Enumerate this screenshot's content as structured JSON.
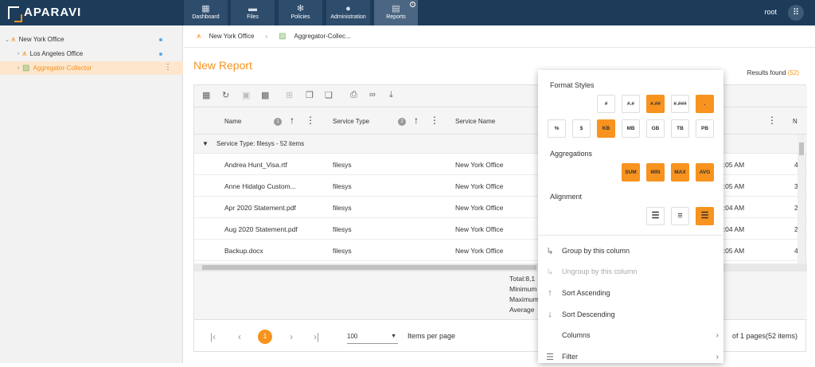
{
  "brand": {
    "name": "APARAVI"
  },
  "nav": {
    "tabs": [
      {
        "label": "Dashboard",
        "icon": "dashboard-icon"
      },
      {
        "label": "Files",
        "icon": "folder-icon"
      },
      {
        "label": "Policies",
        "icon": "gear-icon"
      },
      {
        "label": "Administration",
        "icon": "users-icon"
      },
      {
        "label": "Reports",
        "icon": "clipboard-icon"
      }
    ],
    "user": "root"
  },
  "tree": {
    "items": [
      {
        "label": "New York Office",
        "level": 0
      },
      {
        "label": "Los Angeles Office",
        "level": 1
      },
      {
        "label": "Aggregator-Collector",
        "level": 1,
        "selected": true
      }
    ]
  },
  "breadcrumb": {
    "items": [
      "New York Office",
      "Aggregator-Collec..."
    ]
  },
  "report": {
    "title": "New Report",
    "results_label": "Results found",
    "results_count": "(52)"
  },
  "grid": {
    "columns": [
      {
        "label": "Name",
        "sort_index": "1"
      },
      {
        "label": "Service Type",
        "sort_index": "2"
      },
      {
        "label": "Service Name"
      },
      {
        "label": "N"
      }
    ],
    "group_label": "Service Type: filesys - 52 items",
    "rows": [
      {
        "name": "Andrea Hunt_Visa.rtf",
        "type": "filesys",
        "service": "New York Office",
        "time": "3:05 AM",
        "extra": "4"
      },
      {
        "name": "Anne Hidalgo Custom...",
        "type": "filesys",
        "service": "New York Office",
        "time": "3:05 AM",
        "extra": "3"
      },
      {
        "name": "Apr 2020 Statement.pdf",
        "type": "filesys",
        "service": "New York Office",
        "time": "3:04 AM",
        "extra": "2"
      },
      {
        "name": "Aug 2020 Statement.pdf",
        "type": "filesys",
        "service": "New York Office",
        "time": "3:04 AM",
        "extra": "2"
      },
      {
        "name": "Backup.docx",
        "type": "filesys",
        "service": "New York Office",
        "time": "3:05 AM",
        "extra": "4"
      }
    ],
    "summary": [
      "Total:8,1",
      "Minimum",
      "Maximum",
      "Average"
    ]
  },
  "pager": {
    "current": "1",
    "page_size": "100",
    "items_per_page": "Items per page",
    "page_info": "of 1 pages(52 items)"
  },
  "menu": {
    "format_title": "Format Styles",
    "format_row1": [
      {
        "label": "#",
        "on": false
      },
      {
        "label": "#.#",
        "on": false
      },
      {
        "label": "#.##",
        "on": true
      },
      {
        "label": "#.###",
        "on": false
      },
      {
        "label": ".",
        "on": true
      }
    ],
    "format_row2": [
      {
        "label": "%",
        "on": false
      },
      {
        "label": "$",
        "on": false
      },
      {
        "label": "KB",
        "on": true
      },
      {
        "label": "MB",
        "on": false
      },
      {
        "label": "GB",
        "on": false
      },
      {
        "label": "TB",
        "on": false
      },
      {
        "label": "PB",
        "on": false
      }
    ],
    "agg_title": "Aggregations",
    "aggregations": [
      "SUM",
      "MIN",
      "MAX",
      "AVG"
    ],
    "align_title": "Alignment",
    "items": [
      {
        "label": "Group by this column",
        "disabled": false
      },
      {
        "label": "Ungroup by this column",
        "disabled": true
      },
      {
        "label": "Sort Ascending",
        "disabled": false
      },
      {
        "label": "Sort Descending",
        "disabled": false
      },
      {
        "label": "Columns",
        "disabled": false
      },
      {
        "label": "Filter",
        "disabled": false
      }
    ]
  },
  "colors": {
    "accent": "#f7931e",
    "topbar": "#1d3c5a"
  }
}
